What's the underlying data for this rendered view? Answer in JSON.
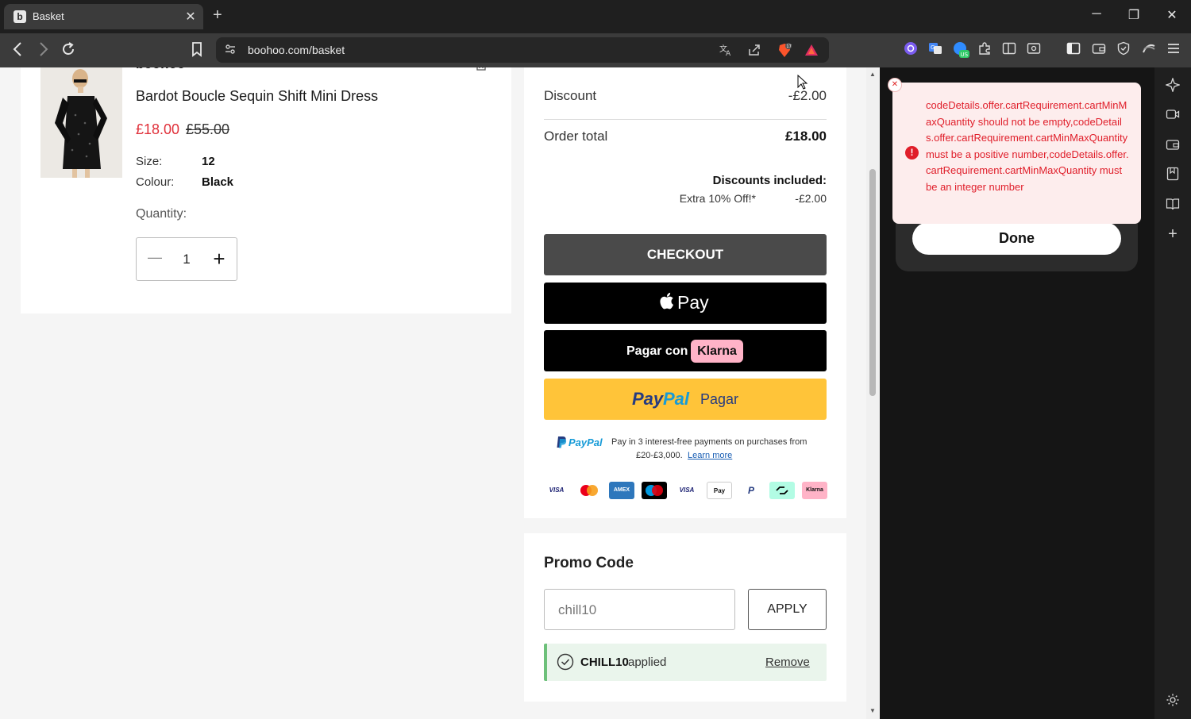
{
  "browser": {
    "tab_title": "Basket",
    "favicon_letter": "b",
    "tab_close": "✕",
    "new_tab": "+",
    "minimize": "─",
    "restore": "❐",
    "close": "✕",
    "url": "boohoo.com/basket",
    "brave_shield_count": "17"
  },
  "product": {
    "brand_partial": "boohoo",
    "name": "Bardot Boucle Sequin Shift Mini Dress",
    "sale_price": "£18.00",
    "original_price": "£55.00",
    "size_label": "Size:",
    "size_value": "12",
    "colour_label": "Colour:",
    "colour_value": "Black",
    "quantity_label": "Quantity:",
    "quantity_value": "1",
    "minus": "—",
    "plus": "+"
  },
  "summary": {
    "discount_label": "Discount",
    "discount_value": "-£2.00",
    "order_total_label": "Order total",
    "order_total_value": "£18.00",
    "discounts_included_label": "Discounts included:",
    "discount_line_label": "Extra 10% Off!*",
    "discount_line_value": "-£2.00",
    "checkout_label": "CHECKOUT",
    "apple_pay_label": "Pay",
    "klarna_prefix": "Pagar con",
    "klarna_brand": "Klarna",
    "paypal_brand_pay": "Pay",
    "paypal_brand_pal": "Pal",
    "paypal_pagar": "Pagar",
    "paypal_info_brand": "PayPal",
    "paypal_info_line1": "Pay in 3 interest-free payments on purchases from",
    "paypal_info_line2": "£20-£3,000.",
    "learn_more": "Learn more",
    "payment_icons": [
      "VISA",
      "mastercard",
      "AMEX",
      "maestro",
      "VISA",
      "Pay",
      "P",
      "clearpay",
      "Klarna"
    ]
  },
  "promo": {
    "title": "Promo Code",
    "input_value": "chill10",
    "apply_label": "APPLY",
    "applied_code": "CHILL10",
    "applied_text": "applied",
    "remove_label": "Remove"
  },
  "sidepanel": {
    "error_message": "codeDetails.offer.cartRequirement.cartMinMaxQuantity should not be empty,codeDetails.offer.cartRequirement.cartMinMaxQuantity must be a positive number,codeDetails.offer.cartRequirement.cartMinMaxQuantity must be an integer number",
    "done_label": "Done"
  },
  "colors": {
    "sale_red": "#e0303a",
    "checkout_bg": "#4a4a4a",
    "paypal_yellow": "#ffc439",
    "klarna_pink": "#ffb3c7",
    "applied_green": "#6dc07a",
    "error_red": "#e01e2a"
  }
}
